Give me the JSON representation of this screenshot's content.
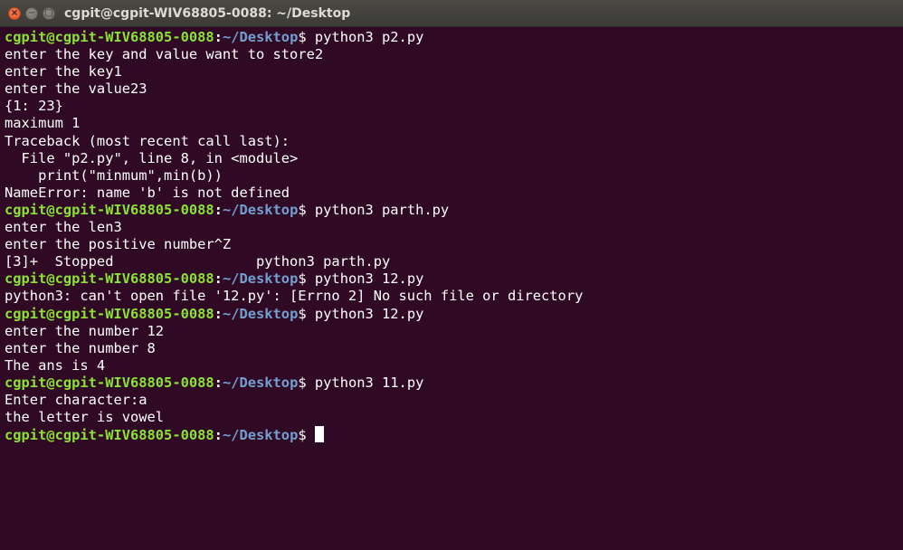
{
  "window": {
    "title": "cgpit@cgpit-WIV68805-0088: ~/Desktop",
    "close_glyph": "×",
    "minimize_glyph": "−",
    "maximize_glyph": "□"
  },
  "prompt": {
    "user_host": "cgpit@cgpit-WIV68805-0088",
    "separator": ":",
    "path": "~/Desktop",
    "symbol": "$"
  },
  "colors": {
    "background": "#300a24",
    "user_host": "#8ae234",
    "path": "#729fcf",
    "text": "#ffffff"
  },
  "lines": [
    {
      "prompt": true,
      "text": " python3 p2.py"
    },
    {
      "text": "enter the key and value want to store2"
    },
    {
      "text": "enter the key1"
    },
    {
      "text": "enter the value23"
    },
    {
      "text": "{1: 23}"
    },
    {
      "text": "maximum 1"
    },
    {
      "text": "Traceback (most recent call last):"
    },
    {
      "text": "  File \"p2.py\", line 8, in <module>"
    },
    {
      "text": "    print(\"minmum\",min(b))"
    },
    {
      "text": "NameError: name 'b' is not defined"
    },
    {
      "prompt": true,
      "text": " python3 parth.py"
    },
    {
      "text": "enter the len3"
    },
    {
      "text": "enter the positive number^Z"
    },
    {
      "text": "[3]+  Stopped                 python3 parth.py"
    },
    {
      "prompt": true,
      "text": " python3 12.py"
    },
    {
      "text": "python3: can't open file '12.py': [Errno 2] No such file or directory"
    },
    {
      "prompt": true,
      "text": " python3 12.py"
    },
    {
      "text": "enter the number 12"
    },
    {
      "text": "enter the number 8"
    },
    {
      "text": "The ans is 4"
    },
    {
      "prompt": true,
      "text": " python3 11.py"
    },
    {
      "text": "Enter character:a"
    },
    {
      "text": "the letter is vowel"
    },
    {
      "prompt": true,
      "text": " ",
      "cursor": true
    }
  ]
}
